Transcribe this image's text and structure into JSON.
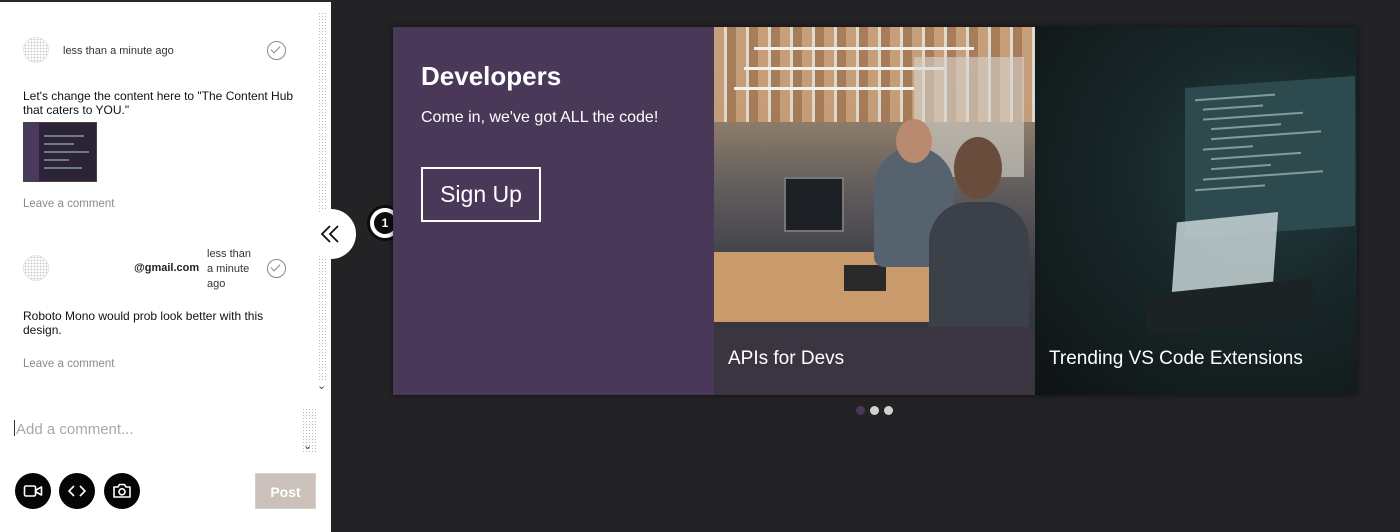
{
  "comments": [
    {
      "author_email": "",
      "time": "less than a minute ago",
      "text": "Let's change the content here to \"The Content Hub that caters to YOU.\"",
      "has_attachment": true,
      "leave_comment_label": "Leave a comment"
    },
    {
      "author_email": "@gmail.com",
      "time_line1": "less than",
      "time_line2": "a minute",
      "time_line3": "ago",
      "text": "Roboto Mono would prob look better with this design.",
      "has_attachment": false,
      "leave_comment_label": "Leave a comment"
    }
  ],
  "composer": {
    "placeholder": "Add a comment...",
    "post_label": "Post",
    "buttons": [
      "video-icon",
      "code-icon",
      "camera-icon"
    ]
  },
  "collapse_icon": "double-chevron-left-icon",
  "marker_number": "1",
  "hero": {
    "title": "Developers",
    "subtitle": "Come in, we've got ALL the code!",
    "cta_label": "Sign Up",
    "tiles": [
      {
        "label": "APIs for Devs"
      },
      {
        "label": "Trending VS Code Extensions"
      }
    ],
    "dots_total": 3,
    "dots_active_index": 0
  },
  "colors": {
    "background": "#232326",
    "hero_purple": "#4a3859",
    "post_button": "#cbc0ba"
  }
}
